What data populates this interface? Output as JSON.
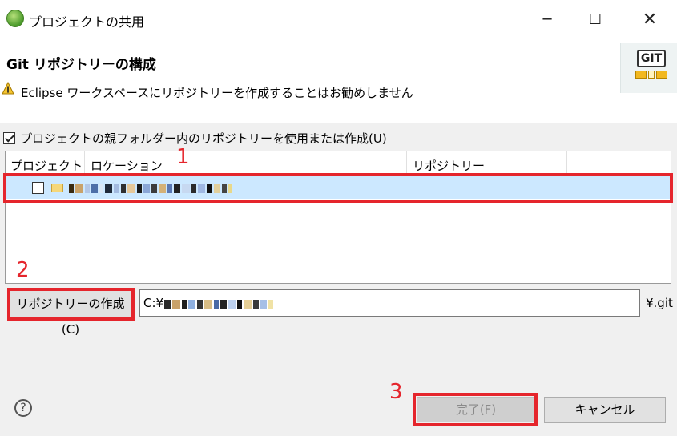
{
  "window": {
    "title": "プロジェクトの共用",
    "minimize_glyph": "─",
    "maximize_glyph": "☐",
    "close_glyph": "✕"
  },
  "banner": {
    "title": "Git リポジトリーの構成",
    "message": "Eclipse ワークスペースにリポジトリーを作成することはお勧めしません",
    "logo_text": "GIT"
  },
  "use_parent_checkbox": {
    "label": "プロジェクトの親フォルダー内のリポジトリーを使用または作成(U)",
    "checked": true
  },
  "table": {
    "columns": [
      "プロジェクト",
      "ロケーション",
      "リポジトリー"
    ],
    "rows": [
      {
        "checked": false,
        "selected": true
      }
    ]
  },
  "create_repo_button": {
    "label": "リポジトリーの作成(C)"
  },
  "path_field": {
    "prefix": "C:¥"
  },
  "path_suffix": ".git",
  "path_suffix_full": "¥.git",
  "buttons": {
    "help_glyph": "?",
    "finish": "完了(F)",
    "cancel": "キャンセル"
  },
  "annotations": {
    "mark1": "1",
    "mark2": "2",
    "mark3": "3"
  },
  "colors": {
    "annotation": "#e5252c",
    "selection": "#cce8ff"
  }
}
